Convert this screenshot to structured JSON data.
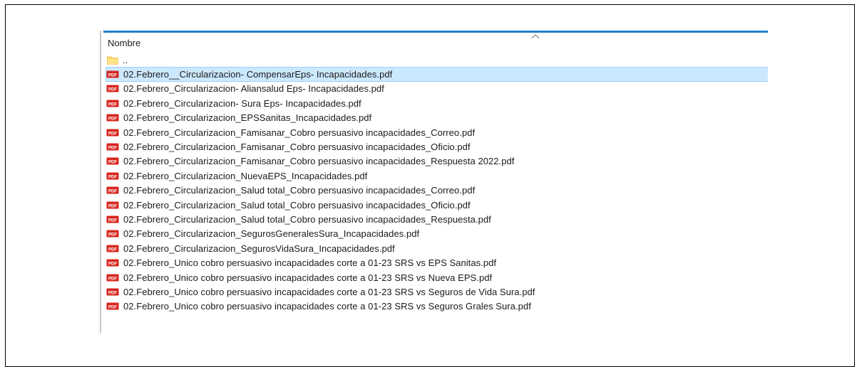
{
  "explorer": {
    "column_header": "Nombre",
    "sort_indicator": "chevron-up-icon",
    "parent_folder_label": "..",
    "accent_color": "#1e7fd0",
    "selected_row_color": "#cce8ff",
    "files": [
      "02.Febrero__Circularizacion- CompensarEps- Incapacidades.pdf",
      "02.Febrero_Circularizacion- Aliansalud Eps- Incapacidades.pdf",
      "02.Febrero_Circularizacion- Sura  Eps- Incapacidades.pdf",
      "02.Febrero_Circularizacion_EPSSanitas_Incapacidades.pdf",
      "02.Febrero_Circularizacion_Famisanar_Cobro persuasivo incapacidades_Correo.pdf",
      "02.Febrero_Circularizacion_Famisanar_Cobro persuasivo incapacidades_Oficio.pdf",
      "02.Febrero_Circularizacion_Famisanar_Cobro persuasivo incapacidades_Respuesta 2022.pdf",
      "02.Febrero_Circularizacion_NuevaEPS_Incapacidades.pdf",
      "02.Febrero_Circularizacion_Salud total_Cobro persuasivo incapacidades_Correo.pdf",
      "02.Febrero_Circularizacion_Salud total_Cobro persuasivo incapacidades_Oficio.pdf",
      "02.Febrero_Circularizacion_Salud total_Cobro persuasivo incapacidades_Respuesta.pdf",
      "02.Febrero_Circularizacion_SegurosGeneralesSura_Incapacidades.pdf",
      "02.Febrero_Circularizacion_SegurosVidaSura_Incapacidades.pdf",
      "02.Febrero_Unico cobro persuasivo incapacidades corte a 01-23 SRS vs EPS Sanitas.pdf",
      "02.Febrero_Unico cobro persuasivo incapacidades corte a 01-23 SRS vs Nueva EPS.pdf",
      "02.Febrero_Unico cobro persuasivo incapacidades corte a 01-23 SRS vs Seguros de Vida Sura.pdf",
      "02.Febrero_Unico cobro persuasivo incapacidades corte a 01-23 SRS vs Seguros Grales Sura.pdf"
    ],
    "file_icon": "pdf-file-icon",
    "folder_icon": "folder-icon",
    "selected_index": 0
  }
}
